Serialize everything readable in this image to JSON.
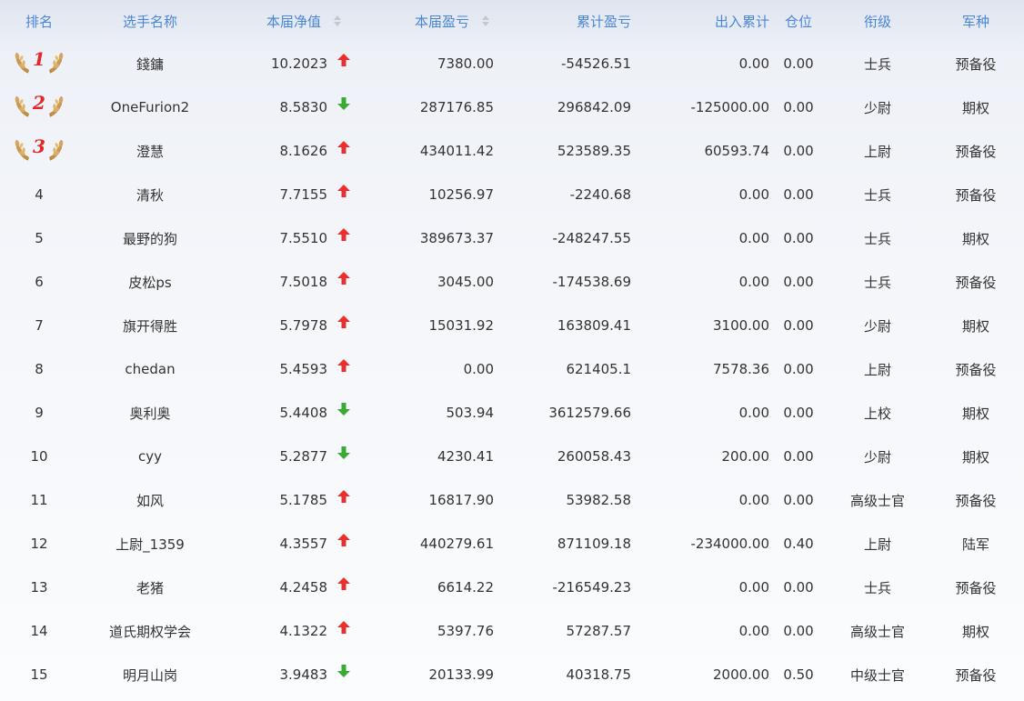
{
  "columns": {
    "rank": "排名",
    "name": "选手名称",
    "nav": "本届净值",
    "pnl": "本届盈亏",
    "cum_pnl": "累计盈亏",
    "flow": "出入累计",
    "position": "仓位",
    "grade": "衔级",
    "branch": "军种"
  },
  "colors": {
    "header_text": "#4a86d8",
    "up_arrow": "#e8302f",
    "down_arrow": "#3aaa35",
    "medal_number": "#e2262a"
  },
  "rows": [
    {
      "rank": "1",
      "medal": true,
      "name": "錢鏞",
      "nav": "10.2023",
      "trend": "up",
      "pnl": "7380.00",
      "cum_pnl": "-54526.51",
      "flow": "0.00",
      "position": "0.00",
      "grade": "士兵",
      "branch": "预备役"
    },
    {
      "rank": "2",
      "medal": true,
      "name": "OneFurion2",
      "nav": "8.5830",
      "trend": "down",
      "pnl": "287176.85",
      "cum_pnl": "296842.09",
      "flow": "-125000.00",
      "position": "0.00",
      "grade": "少尉",
      "branch": "期权"
    },
    {
      "rank": "3",
      "medal": true,
      "name": "澄慧",
      "nav": "8.1626",
      "trend": "up",
      "pnl": "434011.42",
      "cum_pnl": "523589.35",
      "flow": "60593.74",
      "position": "0.00",
      "grade": "上尉",
      "branch": "预备役"
    },
    {
      "rank": "4",
      "medal": false,
      "name": "清秋",
      "nav": "7.7155",
      "trend": "up",
      "pnl": "10256.97",
      "cum_pnl": "-2240.68",
      "flow": "0.00",
      "position": "0.00",
      "grade": "士兵",
      "branch": "预备役"
    },
    {
      "rank": "5",
      "medal": false,
      "name": "最野的狗",
      "nav": "7.5510",
      "trend": "up",
      "pnl": "389673.37",
      "cum_pnl": "-248247.55",
      "flow": "0.00",
      "position": "0.00",
      "grade": "士兵",
      "branch": "期权"
    },
    {
      "rank": "6",
      "medal": false,
      "name": "皮松ps",
      "nav": "7.5018",
      "trend": "up",
      "pnl": "3045.00",
      "cum_pnl": "-174538.69",
      "flow": "0.00",
      "position": "0.00",
      "grade": "士兵",
      "branch": "预备役"
    },
    {
      "rank": "7",
      "medal": false,
      "name": "旗开得胜",
      "nav": "5.7978",
      "trend": "up",
      "pnl": "15031.92",
      "cum_pnl": "163809.41",
      "flow": "3100.00",
      "position": "0.00",
      "grade": "少尉",
      "branch": "期权"
    },
    {
      "rank": "8",
      "medal": false,
      "name": "chedan",
      "nav": "5.4593",
      "trend": "up",
      "pnl": "0.00",
      "cum_pnl": "621405.1",
      "flow": "7578.36",
      "position": "0.00",
      "grade": "上尉",
      "branch": "预备役"
    },
    {
      "rank": "9",
      "medal": false,
      "name": "奥利奥",
      "nav": "5.4408",
      "trend": "down",
      "pnl": "503.94",
      "cum_pnl": "3612579.66",
      "flow": "0.00",
      "position": "0.00",
      "grade": "上校",
      "branch": "期权"
    },
    {
      "rank": "10",
      "medal": false,
      "name": "cyy",
      "nav": "5.2877",
      "trend": "down",
      "pnl": "4230.41",
      "cum_pnl": "260058.43",
      "flow": "200.00",
      "position": "0.00",
      "grade": "少尉",
      "branch": "期权"
    },
    {
      "rank": "11",
      "medal": false,
      "name": "如风",
      "nav": "5.1785",
      "trend": "up",
      "pnl": "16817.90",
      "cum_pnl": "53982.58",
      "flow": "0.00",
      "position": "0.00",
      "grade": "高级士官",
      "branch": "预备役"
    },
    {
      "rank": "12",
      "medal": false,
      "name": "上尉_1359",
      "nav": "4.3557",
      "trend": "up",
      "pnl": "440279.61",
      "cum_pnl": "871109.18",
      "flow": "-234000.00",
      "position": "0.40",
      "grade": "上尉",
      "branch": "陆军"
    },
    {
      "rank": "13",
      "medal": false,
      "name": "老猪",
      "nav": "4.2458",
      "trend": "up",
      "pnl": "6614.22",
      "cum_pnl": "-216549.23",
      "flow": "0.00",
      "position": "0.00",
      "grade": "士兵",
      "branch": "预备役"
    },
    {
      "rank": "14",
      "medal": false,
      "name": "道氏期权学会",
      "nav": "4.1322",
      "trend": "up",
      "pnl": "5397.76",
      "cum_pnl": "57287.57",
      "flow": "0.00",
      "position": "0.00",
      "grade": "高级士官",
      "branch": "期权"
    },
    {
      "rank": "15",
      "medal": false,
      "name": "明月山岗",
      "nav": "3.9483",
      "trend": "down",
      "pnl": "20133.99",
      "cum_pnl": "40318.75",
      "flow": "2000.00",
      "position": "0.50",
      "grade": "中级士官",
      "branch": "预备役"
    }
  ]
}
